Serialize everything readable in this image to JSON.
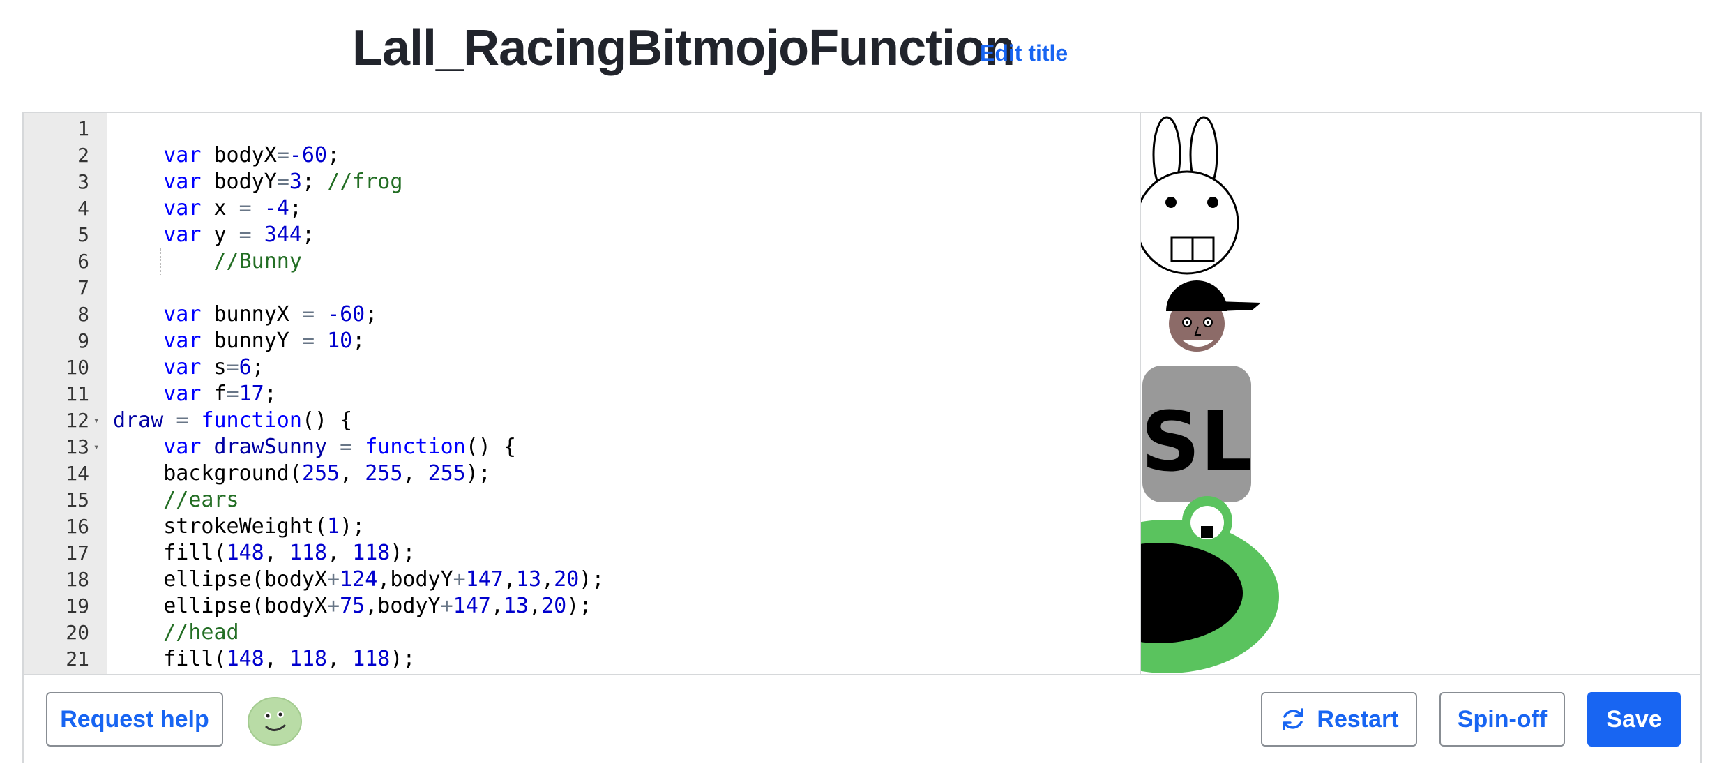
{
  "header": {
    "title": "Lall_RacingBitmojoFunction",
    "edit_title_label": "Edit title"
  },
  "editor": {
    "lines": [
      {
        "num": "1",
        "fold": false,
        "tokens": []
      },
      {
        "num": "2",
        "fold": false,
        "tokens": [
          {
            "t": "    ",
            "c": ""
          },
          {
            "t": "var",
            "c": "kw"
          },
          {
            "t": " bodyX",
            "c": ""
          },
          {
            "t": "=",
            "c": "op"
          },
          {
            "t": "-60",
            "c": "num"
          },
          {
            "t": ";",
            "c": ""
          }
        ]
      },
      {
        "num": "3",
        "fold": false,
        "tokens": [
          {
            "t": "    ",
            "c": ""
          },
          {
            "t": "var",
            "c": "kw"
          },
          {
            "t": " bodyY",
            "c": ""
          },
          {
            "t": "=",
            "c": "op"
          },
          {
            "t": "3",
            "c": "num"
          },
          {
            "t": "; ",
            "c": ""
          },
          {
            "t": "//frog",
            "c": "cm"
          }
        ]
      },
      {
        "num": "4",
        "fold": false,
        "tokens": [
          {
            "t": "    ",
            "c": ""
          },
          {
            "t": "var",
            "c": "kw"
          },
          {
            "t": " x ",
            "c": ""
          },
          {
            "t": "=",
            "c": "op"
          },
          {
            "t": " ",
            "c": ""
          },
          {
            "t": "-4",
            "c": "num"
          },
          {
            "t": ";",
            "c": ""
          }
        ]
      },
      {
        "num": "5",
        "fold": false,
        "tokens": [
          {
            "t": "    ",
            "c": ""
          },
          {
            "t": "var",
            "c": "kw"
          },
          {
            "t": " y ",
            "c": ""
          },
          {
            "t": "=",
            "c": "op"
          },
          {
            "t": " ",
            "c": ""
          },
          {
            "t": "344",
            "c": "num"
          },
          {
            "t": ";",
            "c": ""
          }
        ]
      },
      {
        "num": "6",
        "fold": false,
        "guide": true,
        "tokens": [
          {
            "t": "        ",
            "c": ""
          },
          {
            "t": "//Bunny",
            "c": "cm"
          }
        ]
      },
      {
        "num": "7",
        "fold": false,
        "tokens": []
      },
      {
        "num": "8",
        "fold": false,
        "tokens": [
          {
            "t": "    ",
            "c": ""
          },
          {
            "t": "var",
            "c": "kw"
          },
          {
            "t": " bunnyX ",
            "c": ""
          },
          {
            "t": "=",
            "c": "op"
          },
          {
            "t": " ",
            "c": ""
          },
          {
            "t": "-60",
            "c": "num"
          },
          {
            "t": ";",
            "c": ""
          }
        ]
      },
      {
        "num": "9",
        "fold": false,
        "tokens": [
          {
            "t": "    ",
            "c": ""
          },
          {
            "t": "var",
            "c": "kw"
          },
          {
            "t": " bunnyY ",
            "c": ""
          },
          {
            "t": "=",
            "c": "op"
          },
          {
            "t": " ",
            "c": ""
          },
          {
            "t": "10",
            "c": "num"
          },
          {
            "t": ";",
            "c": ""
          }
        ]
      },
      {
        "num": "10",
        "fold": false,
        "tokens": [
          {
            "t": "    ",
            "c": ""
          },
          {
            "t": "var",
            "c": "kw"
          },
          {
            "t": " s",
            "c": ""
          },
          {
            "t": "=",
            "c": "op"
          },
          {
            "t": "6",
            "c": "num"
          },
          {
            "t": ";",
            "c": ""
          }
        ]
      },
      {
        "num": "11",
        "fold": false,
        "tokens": [
          {
            "t": "    ",
            "c": ""
          },
          {
            "t": "var",
            "c": "kw"
          },
          {
            "t": " f",
            "c": ""
          },
          {
            "t": "=",
            "c": "op"
          },
          {
            "t": "17",
            "c": "num"
          },
          {
            "t": ";",
            "c": ""
          }
        ]
      },
      {
        "num": "12",
        "fold": true,
        "tokens": [
          {
            "t": "draw",
            "c": "fn"
          },
          {
            "t": " ",
            "c": ""
          },
          {
            "t": "=",
            "c": "op"
          },
          {
            "t": " ",
            "c": ""
          },
          {
            "t": "function",
            "c": "kw"
          },
          {
            "t": "() {",
            "c": ""
          }
        ]
      },
      {
        "num": "13",
        "fold": true,
        "tokens": [
          {
            "t": "    ",
            "c": ""
          },
          {
            "t": "var",
            "c": "kw"
          },
          {
            "t": " ",
            "c": ""
          },
          {
            "t": "drawSunny",
            "c": "fn"
          },
          {
            "t": " ",
            "c": ""
          },
          {
            "t": "=",
            "c": "op"
          },
          {
            "t": " ",
            "c": ""
          },
          {
            "t": "function",
            "c": "kw"
          },
          {
            "t": "() {",
            "c": ""
          }
        ]
      },
      {
        "num": "14",
        "fold": false,
        "tokens": [
          {
            "t": "    background(",
            "c": ""
          },
          {
            "t": "255",
            "c": "num"
          },
          {
            "t": ", ",
            "c": ""
          },
          {
            "t": "255",
            "c": "num"
          },
          {
            "t": ", ",
            "c": ""
          },
          {
            "t": "255",
            "c": "num"
          },
          {
            "t": ");",
            "c": ""
          }
        ]
      },
      {
        "num": "15",
        "fold": false,
        "tokens": [
          {
            "t": "    ",
            "c": ""
          },
          {
            "t": "//ears",
            "c": "cm"
          }
        ]
      },
      {
        "num": "16",
        "fold": false,
        "tokens": [
          {
            "t": "    strokeWeight(",
            "c": ""
          },
          {
            "t": "1",
            "c": "num"
          },
          {
            "t": ");",
            "c": ""
          }
        ]
      },
      {
        "num": "17",
        "fold": false,
        "tokens": [
          {
            "t": "    fill(",
            "c": ""
          },
          {
            "t": "148",
            "c": "num"
          },
          {
            "t": ", ",
            "c": ""
          },
          {
            "t": "118",
            "c": "num"
          },
          {
            "t": ", ",
            "c": ""
          },
          {
            "t": "118",
            "c": "num"
          },
          {
            "t": ");",
            "c": ""
          }
        ]
      },
      {
        "num": "18",
        "fold": false,
        "tokens": [
          {
            "t": "    ellipse(bodyX",
            "c": ""
          },
          {
            "t": "+",
            "c": "op"
          },
          {
            "t": "124",
            "c": "num"
          },
          {
            "t": ",bodyY",
            "c": ""
          },
          {
            "t": "+",
            "c": "op"
          },
          {
            "t": "147",
            "c": "num"
          },
          {
            "t": ",",
            "c": ""
          },
          {
            "t": "13",
            "c": "num"
          },
          {
            "t": ",",
            "c": ""
          },
          {
            "t": "20",
            "c": "num"
          },
          {
            "t": ");",
            "c": ""
          }
        ]
      },
      {
        "num": "19",
        "fold": false,
        "tokens": [
          {
            "t": "    ellipse(bodyX",
            "c": ""
          },
          {
            "t": "+",
            "c": "op"
          },
          {
            "t": "75",
            "c": "num"
          },
          {
            "t": ",bodyY",
            "c": ""
          },
          {
            "t": "+",
            "c": "op"
          },
          {
            "t": "147",
            "c": "num"
          },
          {
            "t": ",",
            "c": ""
          },
          {
            "t": "13",
            "c": "num"
          },
          {
            "t": ",",
            "c": ""
          },
          {
            "t": "20",
            "c": "num"
          },
          {
            "t": ");",
            "c": ""
          }
        ]
      },
      {
        "num": "20",
        "fold": false,
        "tokens": [
          {
            "t": "    ",
            "c": ""
          },
          {
            "t": "//head",
            "c": "cm"
          }
        ]
      },
      {
        "num": "21",
        "fold": false,
        "tokens": [
          {
            "t": "    fill(",
            "c": ""
          },
          {
            "t": "148",
            "c": "num"
          },
          {
            "t": ", ",
            "c": ""
          },
          {
            "t": "118",
            "c": "num"
          },
          {
            "t": ", ",
            "c": ""
          },
          {
            "t": "118",
            "c": "num"
          },
          {
            "t": ");",
            "c": ""
          }
        ]
      }
    ]
  },
  "canvas": {
    "sign_text": "SL",
    "colors": {
      "frog_green": "#5ac35e",
      "sign_gray": "#999999",
      "face_brown": "#8c6b68"
    }
  },
  "footer": {
    "request_help_label": "Request help",
    "restart_label": "Restart",
    "spinoff_label": "Spin-off",
    "save_label": "Save",
    "accent_color": "#1865f2"
  }
}
